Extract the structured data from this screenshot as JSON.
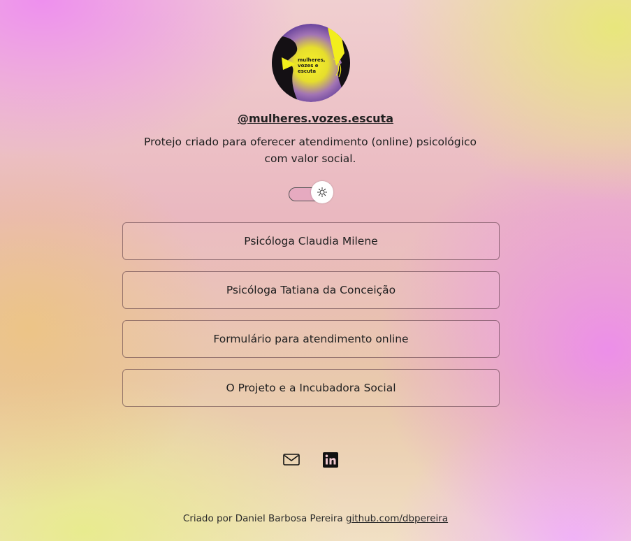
{
  "profile": {
    "handle": "@mulheres.vozes.escuta",
    "description": "Protejo criado para oferecer atendimento (online) psicológico com valor social.",
    "avatar_text": [
      "mulheres,",
      "vozes e",
      "escuta"
    ]
  },
  "theme_toggle": {
    "icon": "sun-icon",
    "state": "light"
  },
  "links": [
    {
      "label": "Psicóloga Claudia Milene"
    },
    {
      "label": "Psicóloga Tatiana da Conceição"
    },
    {
      "label": "Formulário para atendimento online"
    },
    {
      "label": "O Projeto e a Incubadora Social"
    }
  ],
  "socials": [
    {
      "icon": "mail-icon"
    },
    {
      "icon": "linkedin-icon"
    }
  ],
  "footer": {
    "prefix": "Criado por Daniel Barbosa Pereira",
    "link_text": "github.com/dbpereira"
  },
  "colors": {
    "avatar_yellow": "#f2ee1c",
    "avatar_purple": "#6e3fa6",
    "text": "#1f1f1f"
  }
}
